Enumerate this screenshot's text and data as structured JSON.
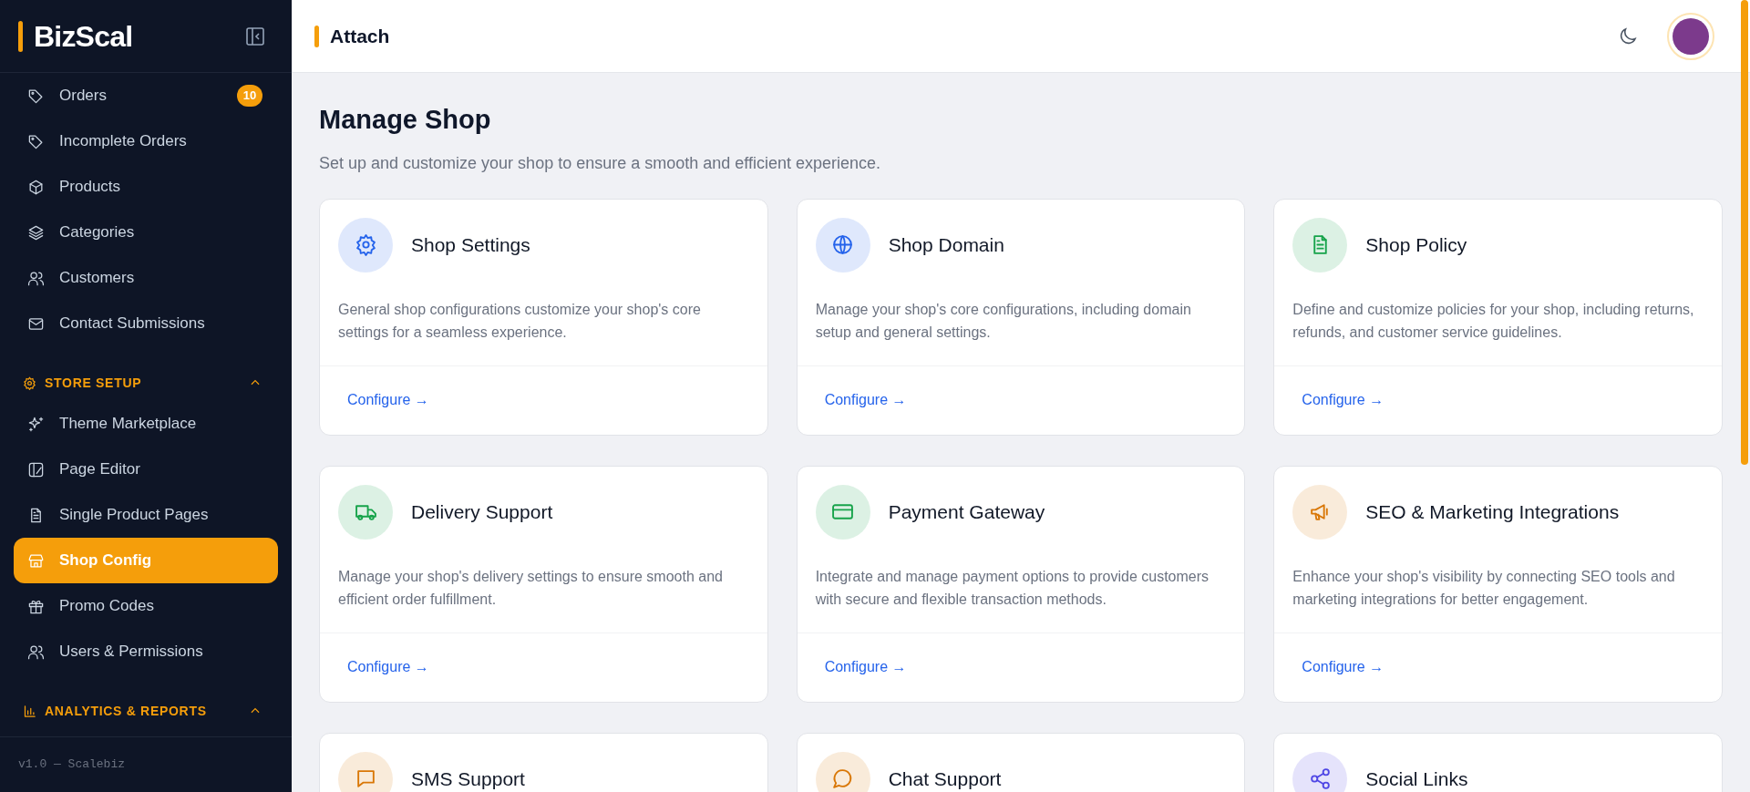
{
  "sidebar": {
    "logo": "BizScal",
    "items": [
      {
        "label": "Orders",
        "kind": "tag",
        "badge": "10",
        "selected": false
      },
      {
        "label": "Incomplete Orders",
        "kind": "tag",
        "selected": false
      },
      {
        "label": "Products",
        "kind": "box",
        "selected": false
      },
      {
        "label": "Categories",
        "kind": "layers",
        "selected": false
      },
      {
        "label": "Customers",
        "kind": "users",
        "selected": false
      },
      {
        "label": "Contact Submissions",
        "kind": "mail",
        "selected": false
      }
    ],
    "sections": [
      {
        "title": "STORE SETUP",
        "kind": "gear",
        "expanded": true,
        "items": [
          {
            "label": "Theme Marketplace",
            "kind": "sparkles",
            "selected": false
          },
          {
            "label": "Page Editor",
            "kind": "palette",
            "selected": false
          },
          {
            "label": "Single Product Pages",
            "kind": "file",
            "selected": false
          },
          {
            "label": "Shop Config",
            "kind": "store",
            "selected": true
          },
          {
            "label": "Promo Codes",
            "kind": "gift",
            "selected": false
          },
          {
            "label": "Users & Permissions",
            "kind": "users",
            "selected": false
          }
        ]
      },
      {
        "title": "ANALYTICS & REPORTS",
        "kind": "chart",
        "expanded": true
      }
    ],
    "footer": "v1.0 — Scalebiz"
  },
  "header": {
    "title": "Attach"
  },
  "page": {
    "title": "Manage Shop",
    "subtitle": "Set up and customize your shop to ensure a smooth and efficient experience.",
    "cards": [
      {
        "title": "Shop Settings",
        "kind": "gear",
        "color": "#2563eb",
        "description": "General shop configurations customize your shop's core settings for a seamless experience.",
        "link": "Configure →"
      },
      {
        "title": "Shop Domain",
        "kind": "globe",
        "color": "#2563eb",
        "description": "Manage your shop's core configurations, including domain setup and general settings.",
        "link": "Configure →"
      },
      {
        "title": "Shop Policy",
        "kind": "file",
        "color": "#16a34a",
        "description": "Define and customize policies for your shop, including returns, refunds, and customer service guidelines.",
        "link": "Configure →"
      },
      {
        "title": "Delivery Support",
        "kind": "truck",
        "color": "#16a34a",
        "description": "Manage your shop's delivery settings to ensure smooth and efficient order fulfillment.",
        "link": "Configure →"
      },
      {
        "title": "Payment Gateway",
        "kind": "card",
        "color": "#16a34a",
        "description": "Integrate and manage payment options to provide customers with secure and flexible transaction methods.",
        "link": "Configure →"
      },
      {
        "title": "SEO & Marketing Integrations",
        "kind": "megaphone",
        "color": "#d97706",
        "description": "Enhance your shop's visibility by connecting SEO tools and marketing integrations for better engagement.",
        "link": "Configure →"
      },
      {
        "title": "SMS Support",
        "kind": "message",
        "color": "#d97706"
      },
      {
        "title": "Chat Support",
        "kind": "chat",
        "color": "#d97706"
      },
      {
        "title": "Social Links",
        "kind": "share",
        "color": "#4f46e5"
      }
    ]
  }
}
